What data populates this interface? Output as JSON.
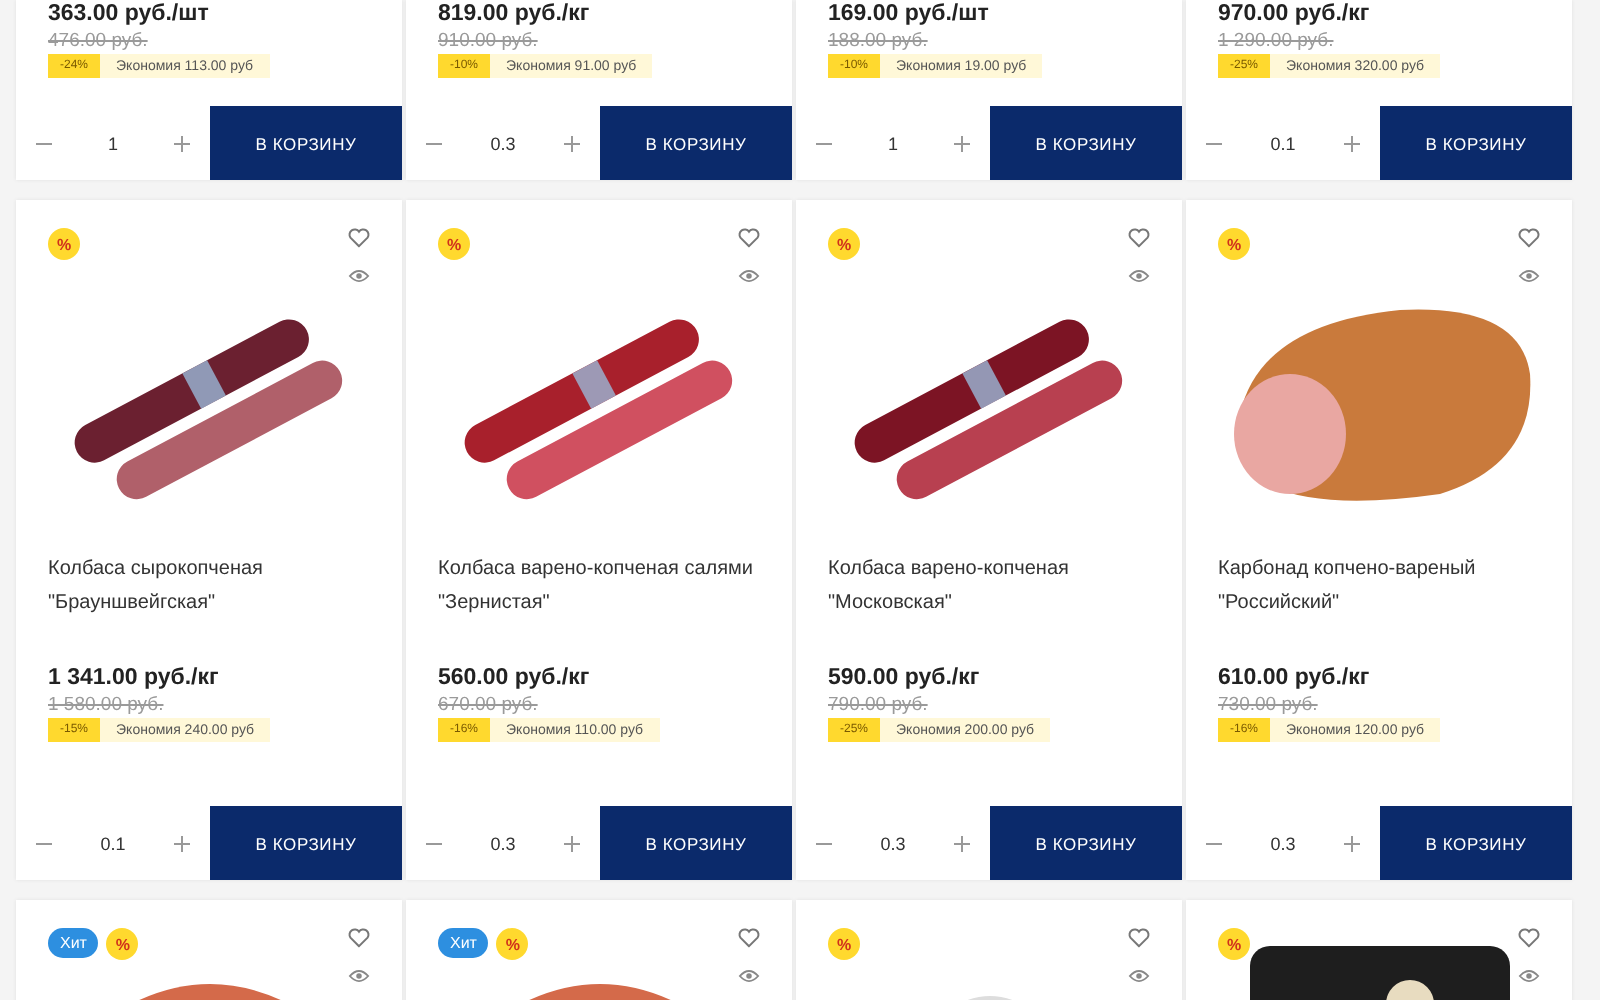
{
  "top_row": [
    {
      "price": "363.00 руб./шт",
      "old_price": "476.00 руб.",
      "discount": "-24%",
      "savings": "Экономия 113.00 руб",
      "quantity": "1",
      "button": "В КОРЗИНУ"
    },
    {
      "price": "819.00 руб./кг",
      "old_price": "910.00 руб.",
      "discount": "-10%",
      "savings": "Экономия 91.00 руб",
      "quantity": "0.3",
      "button": "В КОРЗИНУ"
    },
    {
      "price": "169.00 руб./шт",
      "old_price": "188.00 руб.",
      "discount": "-10%",
      "savings": "Экономия 19.00 руб",
      "quantity": "1",
      "button": "В КОРЗИНУ"
    },
    {
      "price": "970.00 руб./кг",
      "old_price": "1 290.00 руб.",
      "discount": "-25%",
      "savings": "Экономия 320.00 руб",
      "quantity": "0.1",
      "button": "В КОРЗИНУ"
    }
  ],
  "products": [
    {
      "badges": [
        {
          "kind": "sale",
          "text": "%"
        }
      ],
      "kind": "dry-sausages",
      "name": "Колбаса сырокопченая \"Брауншвейгская\"",
      "price": "1 341.00 руб./кг",
      "old_price": "1 580.00 руб.",
      "discount": "-15%",
      "savings": "Экономия 240.00 руб",
      "quantity": "0.1",
      "button": "В КОРЗИНУ"
    },
    {
      "badges": [
        {
          "kind": "sale",
          "text": "%"
        }
      ],
      "kind": "red-sausages",
      "name": "Колбаса варено-копченая салями \"Зернистая\"",
      "price": "560.00 руб./кг",
      "old_price": "670.00 руб.",
      "discount": "-16%",
      "savings": "Экономия 110.00 руб",
      "quantity": "0.3",
      "button": "В КОРЗИНУ"
    },
    {
      "badges": [
        {
          "kind": "sale",
          "text": "%"
        }
      ],
      "kind": "dark-sausages",
      "name": "Колбаса варено-копченая \"Московская\"",
      "price": "590.00 руб./кг",
      "old_price": "790.00 руб.",
      "discount": "-25%",
      "savings": "Экономия 200.00 руб",
      "quantity": "0.3",
      "button": "В КОРЗИНУ"
    },
    {
      "badges": [
        {
          "kind": "sale",
          "text": "%"
        }
      ],
      "kind": "ham",
      "name": "Карбонад копчено-вареный \"Российский\"",
      "price": "610.00 руб./кг",
      "old_price": "730.00 руб.",
      "discount": "-16%",
      "savings": "Экономия 120.00 руб",
      "quantity": "0.3",
      "button": "В КОРЗИНУ"
    }
  ],
  "bottom_row": [
    {
      "badges": [
        {
          "kind": "hit",
          "text": "Хит"
        },
        {
          "kind": "sale",
          "text": "%"
        }
      ],
      "kind": "meat"
    },
    {
      "badges": [
        {
          "kind": "hit",
          "text": "Хит"
        },
        {
          "kind": "sale",
          "text": "%"
        }
      ],
      "kind": "meat"
    },
    {
      "badges": [
        {
          "kind": "sale",
          "text": "%"
        }
      ],
      "kind": "white"
    },
    {
      "badges": [
        {
          "kind": "sale",
          "text": "%"
        }
      ],
      "kind": "tray"
    }
  ]
}
